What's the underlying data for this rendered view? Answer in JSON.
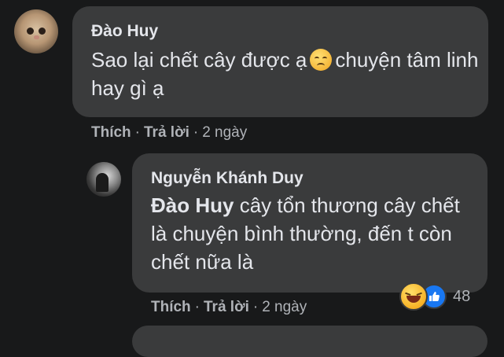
{
  "comments": [
    {
      "author": "Đào Huy",
      "text_before_emoji": "Sao lại chết cây được ạ",
      "text_after_emoji": "chuyện tâm linh hay gì ạ",
      "emoji": "disappointed-face-icon",
      "actions": {
        "like": "Thích",
        "reply": "Trả lời",
        "time": "2 ngày"
      }
    },
    {
      "author": "Nguyễn Khánh Duy",
      "mention": "Đào Huy",
      "text": "cây tổn thương cây chết là chuyện bình thường, đến t còn chết nữa là",
      "actions": {
        "like": "Thích",
        "reply": "Trả lời",
        "time": "2 ngày"
      },
      "reactions": {
        "icons": [
          "laughing-face-icon",
          "like-thumb-icon"
        ],
        "count": "48"
      }
    }
  ],
  "separator": "·",
  "colors": {
    "background": "#18191a",
    "bubble": "#3a3b3c",
    "text": "#e4e6eb",
    "muted": "#b0b3b8",
    "like_blue": "#1877f2"
  }
}
